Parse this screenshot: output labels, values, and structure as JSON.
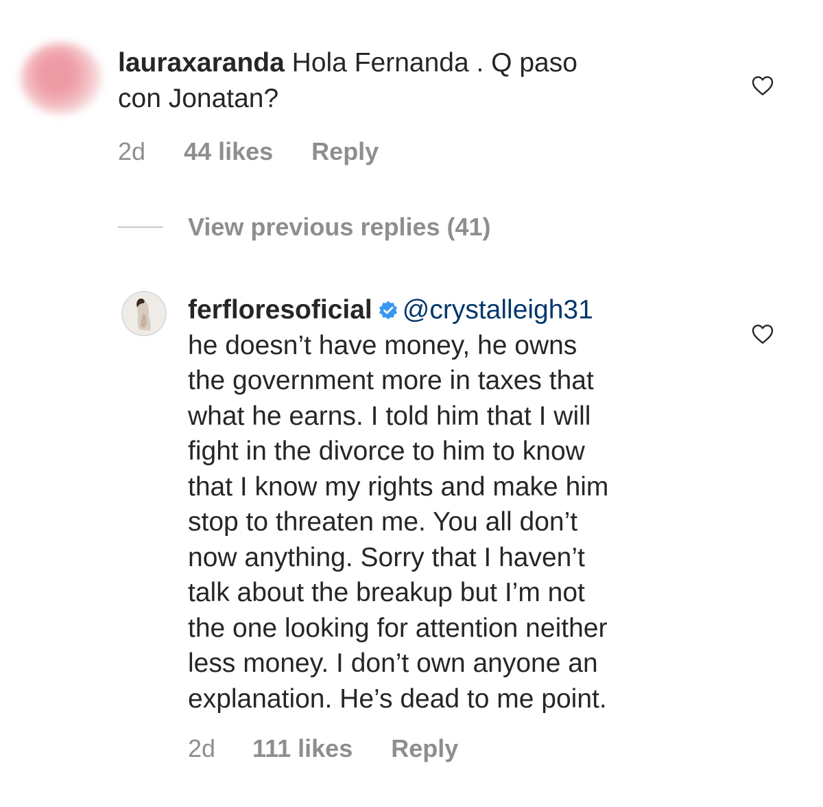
{
  "comments": [
    {
      "username": "lauraxaranda",
      "text": " Hola Fernanda .  Q paso\ncon Jonatan?",
      "age": "2d",
      "likes": "44 likes",
      "reply_label": "Reply"
    }
  ],
  "view_previous_replies": "View previous replies (41)",
  "reply": {
    "username": "ferfloresoficial",
    "verified": true,
    "mention": "@crystalleigh31",
    "text": "he doesn’t have money, he owns\nthe government more in taxes that\nwhat he earns. I told him that I will\nfight in the divorce to him to know\nthat I know my rights and make him\nstop to threaten me. You all don’t\nnow anything. Sorry that I haven’t\ntalk about the breakup but I’m not\nthe one looking for attention neither\nless money. I don’t own anyone an\nexplanation. He’s dead to me point.",
    "age": "2d",
    "likes": "111 likes",
    "reply_label": "Reply"
  },
  "colors": {
    "text": "#262626",
    "secondary": "#8e8e8e",
    "mention": "#00376b",
    "verified": "#3897f0"
  },
  "icons": [
    "heart-outline-icon",
    "verified-badge-icon"
  ]
}
